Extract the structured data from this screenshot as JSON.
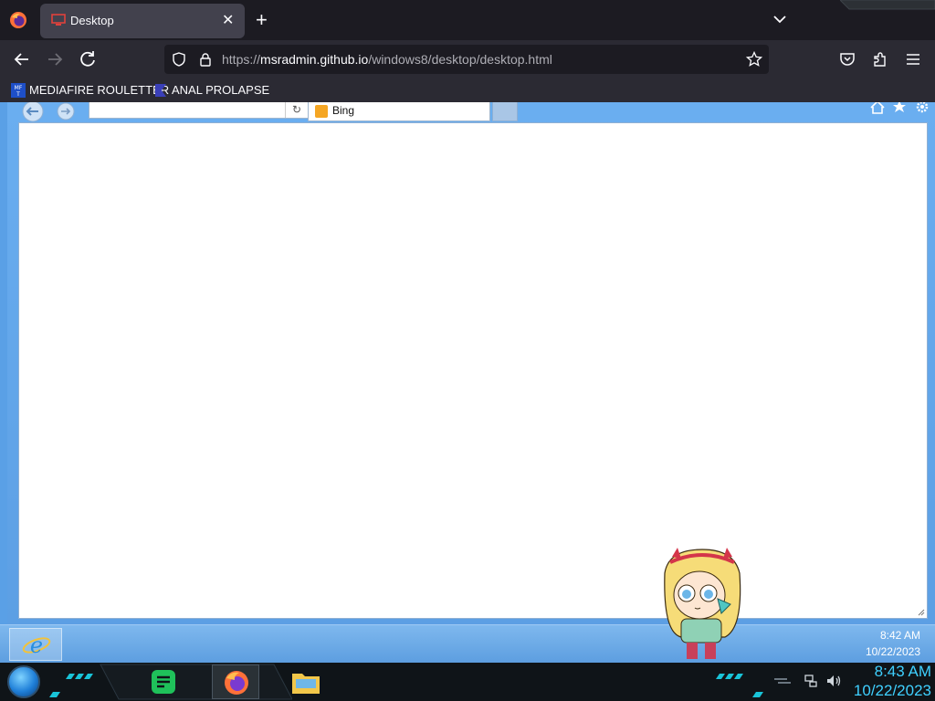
{
  "browser": {
    "tab": {
      "title": "Desktop"
    },
    "url": {
      "prefix": "https://",
      "host": "msradmin.github.io",
      "path": "/windows8/desktop/desktop.html"
    },
    "bookmarks": [
      {
        "label": "MEDIAFIRE ROULETTER",
        "icon": "mediafire-icon"
      },
      {
        "label": "ANAL PROLAPSE",
        "icon": "sigma-icon"
      }
    ]
  },
  "ie": {
    "tab_label": "Bing",
    "address_value": ""
  },
  "win8_taskbar": {
    "time": "8:42 AM",
    "date": "10/22/2023"
  },
  "host_taskbar": {
    "time": "8:43 AM",
    "date": "10/22/2023",
    "apps": [
      "start-orb",
      "notes-app-icon",
      "firefox-icon",
      "file-explorer-icon"
    ]
  },
  "colors": {
    "firefox_dark": "#1c1b22",
    "toolbar": "#2b2a33",
    "win8_blue": "#5aa0e6",
    "clock_cyan": "#3fd0ff"
  }
}
